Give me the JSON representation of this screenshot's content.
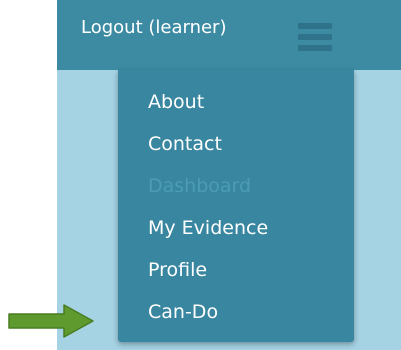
{
  "navbar": {
    "logout_label": "Logout (learner)",
    "menu_icon": "hamburger-menu-icon"
  },
  "dropdown": {
    "items": [
      {
        "label": "About",
        "enabled": true
      },
      {
        "label": "Contact",
        "enabled": true
      },
      {
        "label": "Dashboard",
        "enabled": false
      },
      {
        "label": "My Evidence",
        "enabled": true
      },
      {
        "label": "Profile",
        "enabled": true
      },
      {
        "label": "Can-Do",
        "enabled": true
      }
    ]
  },
  "annotation": {
    "icon": "green-arrow-right-icon",
    "color": "#5e9a2d"
  },
  "colors": {
    "navbar": "#3c8ba3",
    "dropdown": "#3886a0",
    "page_background": "#a6d3e4",
    "disabled_text": "#4b9cb4"
  }
}
